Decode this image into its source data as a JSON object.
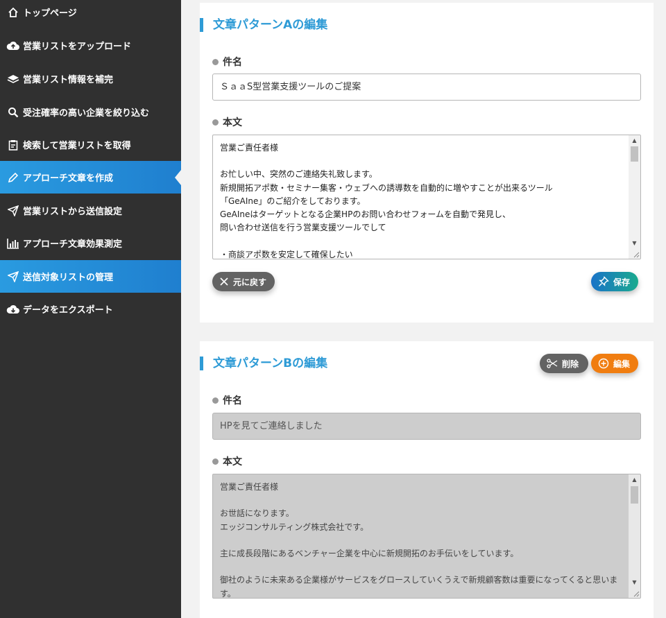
{
  "sidebar": {
    "items": [
      {
        "label": "トップページ",
        "icon": "home-icon"
      },
      {
        "label": "営業リストをアップロード",
        "icon": "cloud-upload-icon"
      },
      {
        "label": "営業リスト情報を補完",
        "icon": "layers-icon"
      },
      {
        "label": "受注確率の高い企業を絞り込む",
        "icon": "search-icon"
      },
      {
        "label": "検索して営業リストを取得",
        "icon": "clipboard-icon"
      },
      {
        "label": "アプローチ文章を作成",
        "icon": "pencil-icon"
      },
      {
        "label": "営業リストから送信設定",
        "icon": "send-icon"
      },
      {
        "label": "アプローチ文章効果測定",
        "icon": "bar-chart-icon"
      },
      {
        "label": "送信対象リストの管理",
        "icon": "send-icon"
      },
      {
        "label": "データをエクスポート",
        "icon": "cloud-download-icon"
      }
    ],
    "active_color": "#2a9be0"
  },
  "pattern_a": {
    "title": "文章パターンAの編集",
    "subject_label": "件名",
    "subject_value": "ＳａａS型営業支援ツールのご提案",
    "body_label": "本文",
    "body_value": "営業ご責任者様\n\nお忙しい中、突然のご連絡失礼致します。\n新規開拓アポ数・セミナー集客・ウェブへの誘導数を自動的に増やすことが出来るツール\n「GeAIne」のご紹介をしております。\nGeAIneはターゲットとなる企業HPのお問い合わせフォームを自動で発見し、\n問い合わせ送信を行う営業支援ツールでして\n\n・商談アポ数を安定して確保したい",
    "revert_button": "元に戻す",
    "save_button": "保存"
  },
  "pattern_b": {
    "title": "文章パターンBの編集",
    "delete_button": "削除",
    "edit_button": "編集",
    "subject_label": "件名",
    "subject_value": "HPを見てご連絡しました",
    "body_label": "本文",
    "body_value": "営業ご責任者様\n\nお世話になります。\nエッジコンサルティング株式会社です。\n\n主に成長段階にあるベンチャー企業を中心に新規開拓のお手伝いをしています。\n\n御社のように未来ある企業様がサービスをグロースしていくうえで新規顧客数は重要になってくると思います。"
  },
  "colors": {
    "accent": "#2e9bd6",
    "orange": "#f07d10",
    "sidebar_bg": "#303030"
  }
}
